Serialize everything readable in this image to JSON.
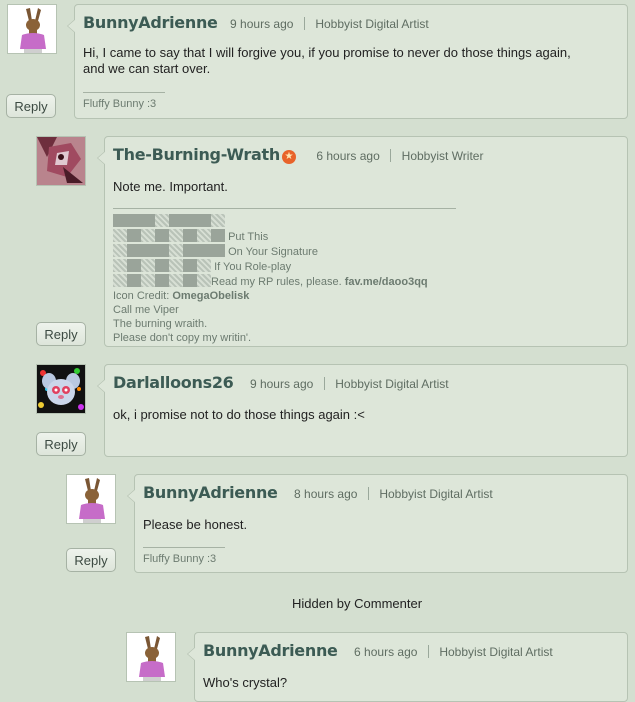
{
  "comments": [
    {
      "username": "BunnyAdrienne",
      "time": "9 hours ago",
      "role": "Hobbyist Digital Artist",
      "text_lines": [
        "Hi, I came to say that I will forgive you, if you promise to never do those things again,",
        "and we can start over."
      ],
      "signature": "Fluffy Bunny :3",
      "reply_label": "Reply"
    },
    {
      "username": "The-Burning-Wrath",
      "time": "6 hours ago",
      "role": "Hobbyist Writer",
      "text": "Note me. Important.",
      "signature_lines": {
        "put_this": "Put This",
        "on_sig": "On Your Signature",
        "roleplay": "If You Role-play",
        "rules_prefix": "Read my RP rules, please. ",
        "rules_link": "fav.me/daoo3qq",
        "icon_prefix": "Icon Credit: ",
        "icon_name": "OmegaObelisk",
        "call_me": "Call me Viper",
        "title": "The burning wraith.",
        "dont_copy": "Please don't copy my writin'."
      },
      "reply_label": "Reply"
    },
    {
      "username": "Darlalloons26",
      "time": "9 hours ago",
      "role": "Hobbyist Digital Artist",
      "text": "ok, i promise not to do those things again :<",
      "reply_label": "Reply"
    },
    {
      "username": "BunnyAdrienne",
      "time": "8 hours ago",
      "role": "Hobbyist Digital Artist",
      "text": "Please be honest.",
      "signature": "Fluffy Bunny :3",
      "reply_label": "Reply"
    },
    {
      "username": "BunnyAdrienne",
      "time": "6 hours ago",
      "role": "Hobbyist Digital Artist",
      "text": "Who's crystal?"
    }
  ],
  "hidden_note": "Hidden by Commenter",
  "colors": {
    "page_bg": "#d4dfd0",
    "box_bg": "#dde6d9",
    "username": "#3c5b54",
    "badge": "#e8632a"
  },
  "icons": [
    "bunny-avatar-icon",
    "wrath-avatar-icon",
    "darlalloons-avatar-icon",
    "watcher-badge-icon"
  ]
}
